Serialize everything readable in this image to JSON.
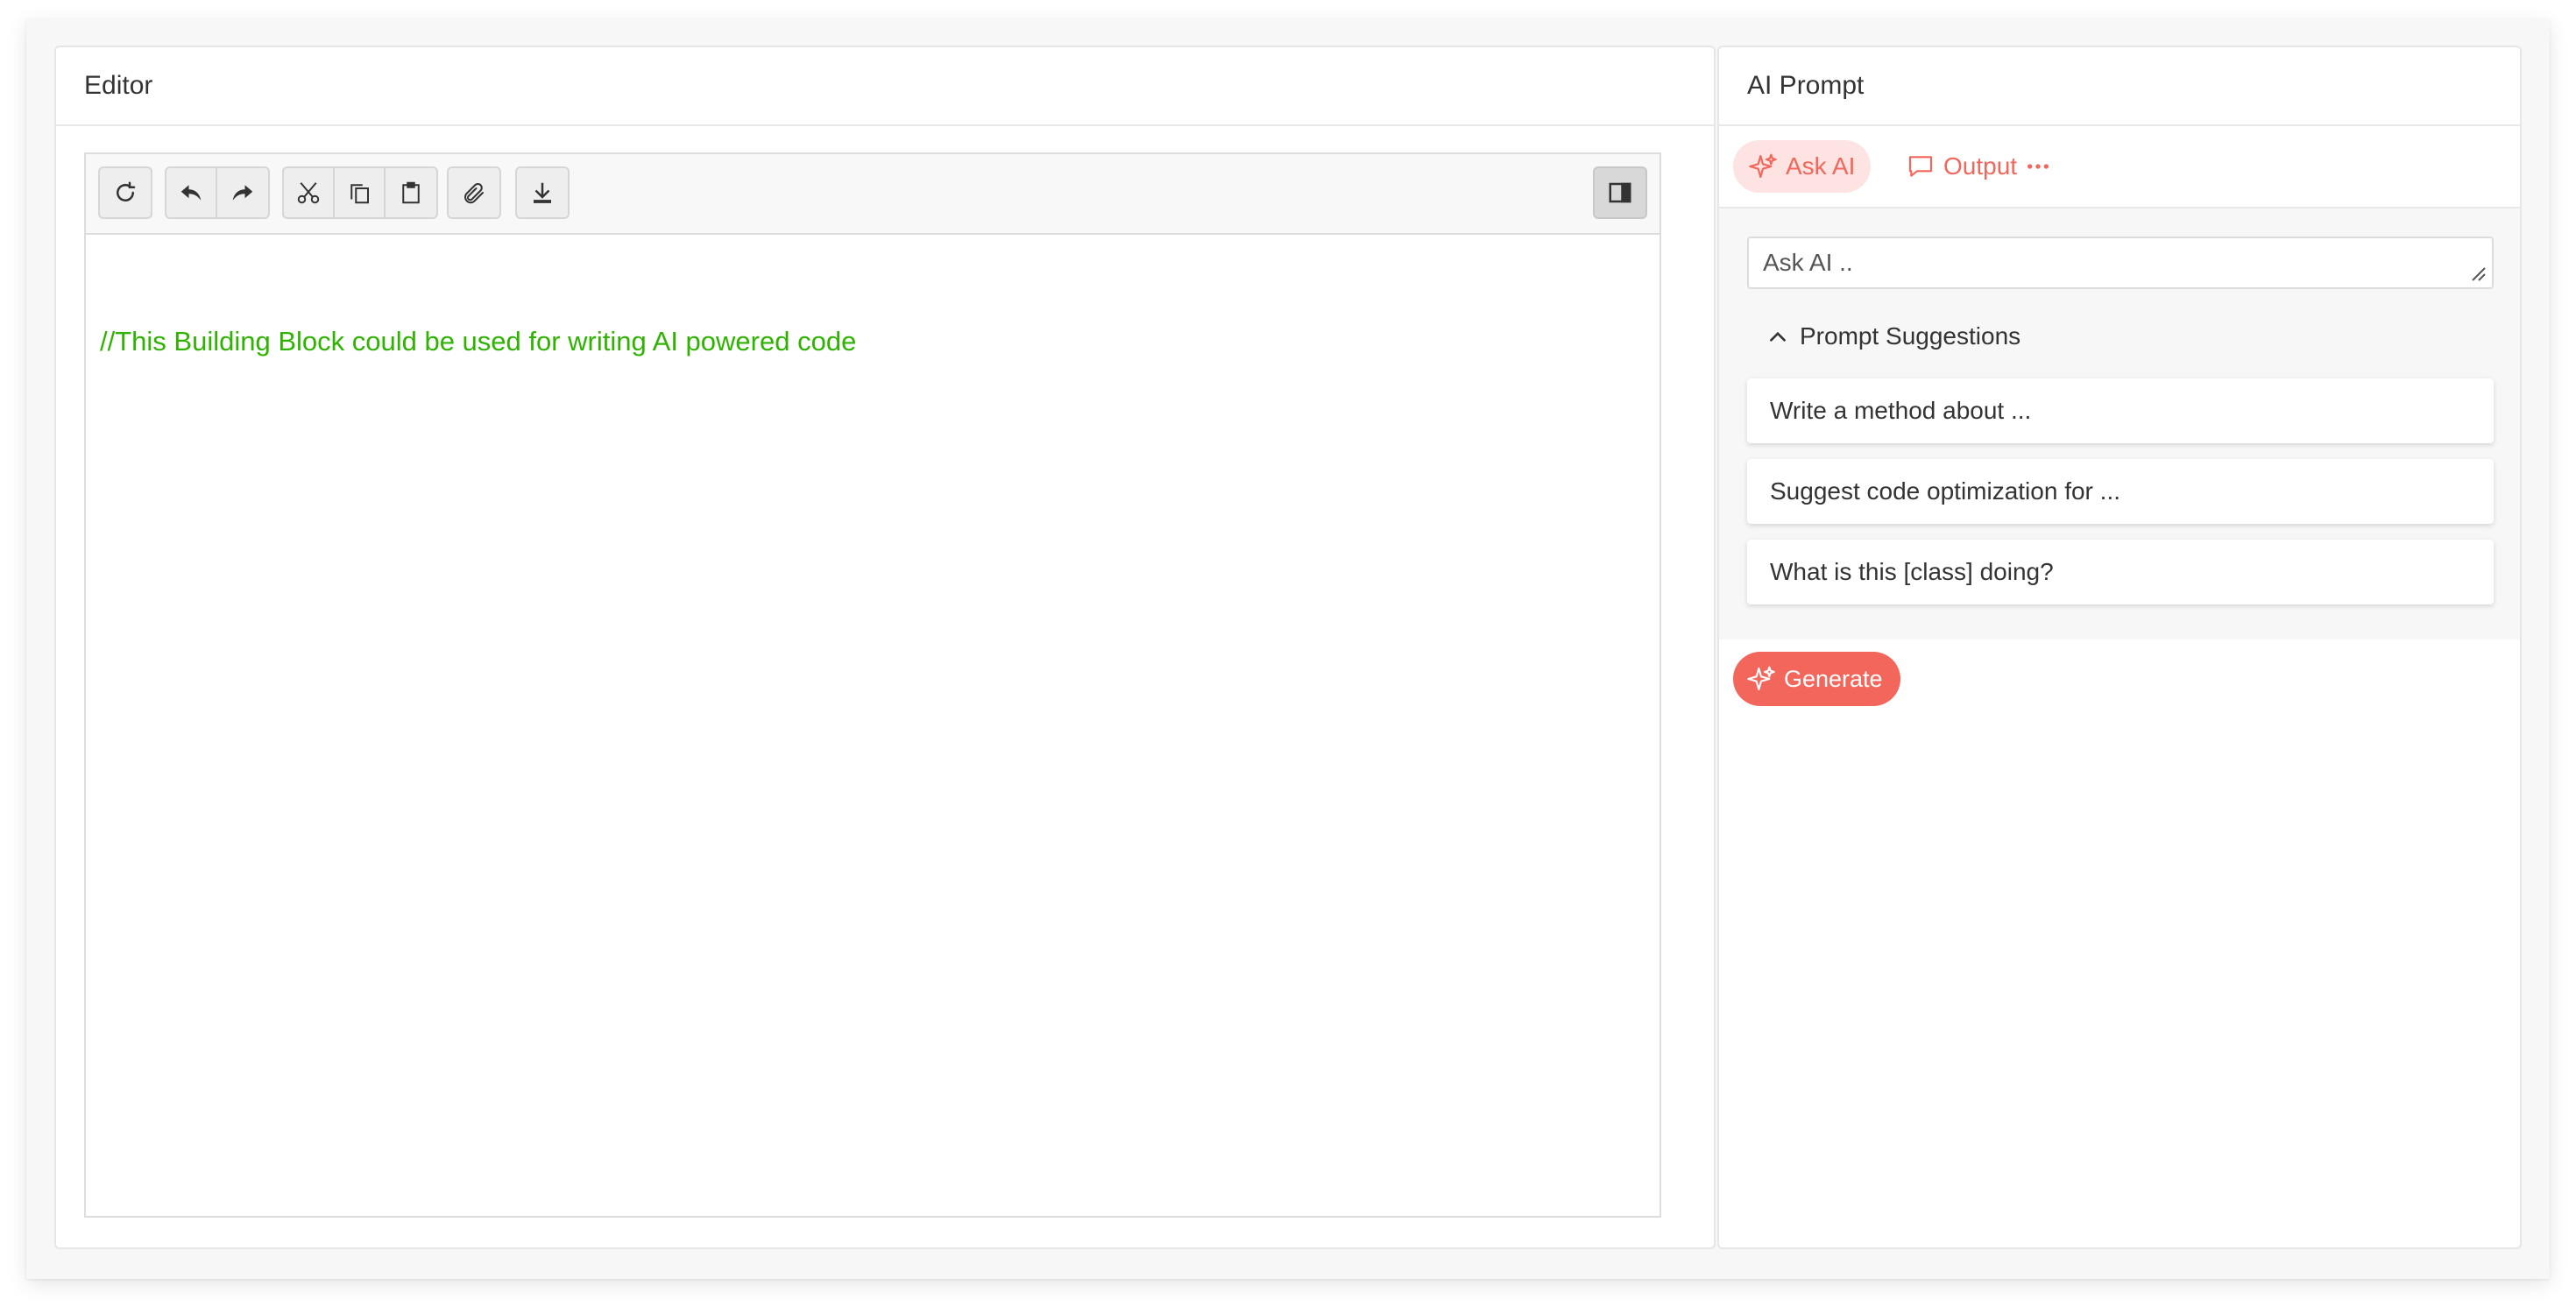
{
  "editor": {
    "title": "Editor",
    "code_line": "//This Building Block could be used for writing AI powered code",
    "toolbar": {
      "icons": [
        "refresh-icon",
        "undo-icon",
        "redo-icon",
        "cut-icon",
        "copy-icon",
        "paste-icon",
        "attach-icon",
        "download-icon",
        "sidebar-toggle-icon"
      ]
    },
    "code_color": "#2eb400"
  },
  "ai_prompt": {
    "title": "AI Prompt",
    "tabs": [
      {
        "label": "Ask AI",
        "icon": "sparkle-icon",
        "active": true
      },
      {
        "label": "Output",
        "icon": "chat-bubble-icon",
        "active": false
      },
      {
        "label": "",
        "icon": "more-dots-icon",
        "active": false
      }
    ],
    "input_placeholder": "Ask AI ..",
    "suggestions_label": "Prompt Suggestions",
    "suggestions": [
      "Write a method about ...",
      "Suggest code optimization for ...",
      "What is this [class] doing?"
    ],
    "generate_label": "Generate",
    "accent_color": "#f2665b"
  }
}
